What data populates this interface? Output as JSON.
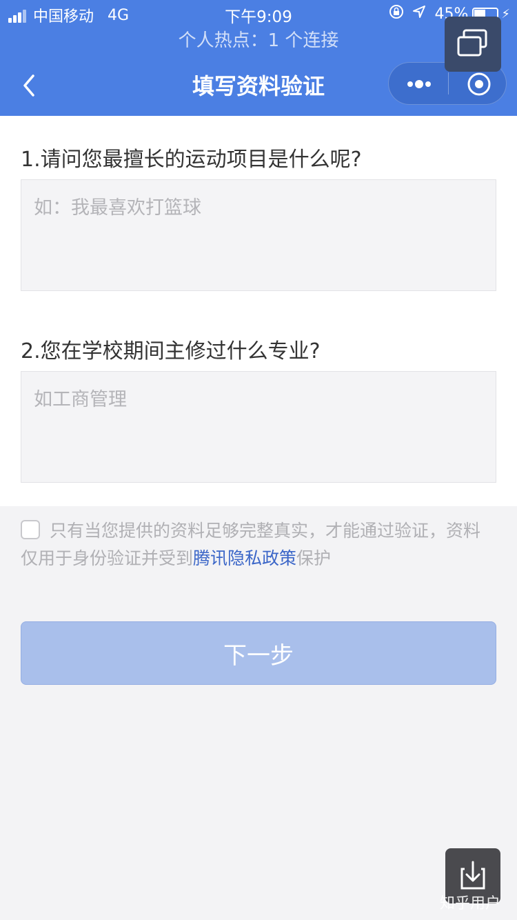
{
  "status_bar": {
    "carrier": "中国移动",
    "network": "4G",
    "time": "下午9:09",
    "battery": "45%"
  },
  "hotspot": {
    "text": "个人热点：1 个连接"
  },
  "nav": {
    "title": "填写资料验证"
  },
  "form": {
    "q1_label": "1.请问您最擅长的运动项目是什么呢?",
    "q1_placeholder": "如：我最喜欢打篮球",
    "q2_label": "2.您在学校期间主修过什么专业?",
    "q2_placeholder": "如工商管理"
  },
  "agreement": {
    "text_before": "只有当您提供的资料足够完整真实，才能通过验证，资料仅用于身份验证并受到",
    "link": "腾讯隐私政策",
    "text_after": "保护",
    "checked": false
  },
  "next_button": {
    "label": "下一步"
  },
  "watermark": {
    "text": "知乎用户"
  },
  "colors": {
    "primary": "#4b7fe3",
    "button_disabled": "#a9bfeb",
    "link": "#3b66c8",
    "page_bg": "#f3f3f5"
  },
  "icons": {
    "back": "chevron-left-icon",
    "more": "more-dots-icon",
    "close": "target-close-icon",
    "float": "float-window-icon",
    "download": "download-icon"
  }
}
